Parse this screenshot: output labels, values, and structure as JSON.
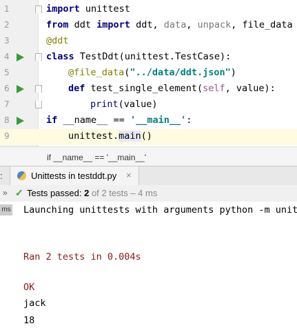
{
  "editor": {
    "lines": [
      {
        "n": "1",
        "tokens": [
          {
            "t": "import",
            "c": "kw"
          },
          {
            "t": " unittest",
            "c": ""
          }
        ]
      },
      {
        "n": "2",
        "tokens": [
          {
            "t": "from",
            "c": "kw"
          },
          {
            "t": " ddt ",
            "c": ""
          },
          {
            "t": "import",
            "c": "kw"
          },
          {
            "t": " ddt, ",
            "c": ""
          },
          {
            "t": "data",
            "c": "gray"
          },
          {
            "t": ", ",
            "c": ""
          },
          {
            "t": "unpack",
            "c": "gray"
          },
          {
            "t": ", file_data",
            "c": ""
          }
        ]
      },
      {
        "n": "3",
        "tokens": [
          {
            "t": "@ddt",
            "c": "dec"
          }
        ]
      },
      {
        "n": "4",
        "tokens": [
          {
            "t": "class",
            "c": "kw"
          },
          {
            "t": " TestDdt(unittest.TestCase):",
            "c": ""
          }
        ]
      },
      {
        "n": "5",
        "tokens": [
          {
            "t": "@file_data",
            "c": "dec"
          },
          {
            "t": "(",
            "c": ""
          },
          {
            "t": "\"../data/ddt.json\"",
            "c": "str"
          },
          {
            "t": ")",
            "c": ""
          }
        ]
      },
      {
        "n": "6",
        "tokens": [
          {
            "t": "def",
            "c": "kw"
          },
          {
            "t": " test_single_element(",
            "c": ""
          },
          {
            "t": "self",
            "c": "self"
          },
          {
            "t": ", value):",
            "c": ""
          }
        ]
      },
      {
        "n": "7",
        "tokens": [
          {
            "t": "print",
            "c": "kw2"
          },
          {
            "t": "(value)",
            "c": ""
          }
        ]
      },
      {
        "n": "8",
        "tokens": [
          {
            "t": "if",
            "c": "kw"
          },
          {
            "t": " __name__ == ",
            "c": ""
          },
          {
            "t": "'__main__'",
            "c": "str"
          },
          {
            "t": ":",
            "c": ""
          }
        ]
      },
      {
        "n": "9",
        "tokens": [
          {
            "t": "unittest.",
            "c": ""
          },
          {
            "t": "main",
            "c": "hl"
          },
          {
            "t": "()",
            "c": ""
          }
        ]
      }
    ]
  },
  "breadcrumb": "if __name__ == '__main__'",
  "run_tab": {
    "colon": ":",
    "label": "Unittests in testddt.py",
    "close": "×"
  },
  "status": {
    "chevron": "»",
    "check": "✓",
    "prefix": "Tests passed: ",
    "count": "2",
    "rest": " of 2 tests – 4 ms"
  },
  "console": {
    "badge": "ms",
    "lines": [
      {
        "text": "Launching unittests with arguments python -m unitt",
        "color": "black"
      },
      {
        "text": "Ran 2 tests in 0.004s",
        "color": "red"
      },
      {
        "text": "OK",
        "color": "red"
      },
      {
        "text": "jack",
        "color": "black"
      },
      {
        "text": "18",
        "color": "black"
      }
    ]
  }
}
